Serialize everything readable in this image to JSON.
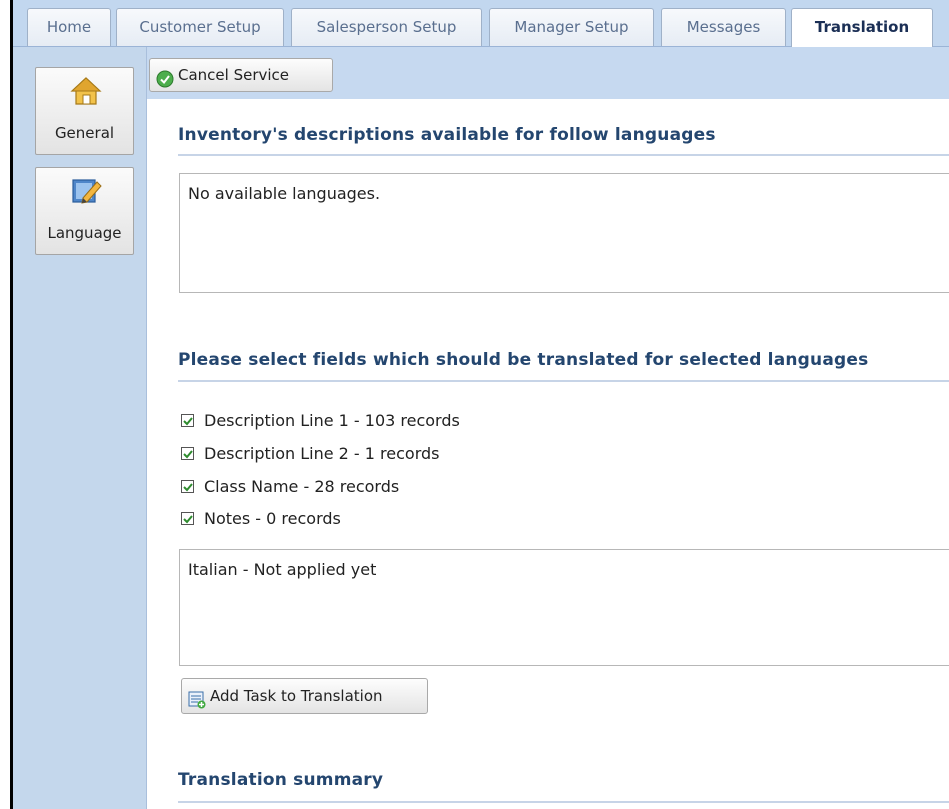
{
  "tabs": [
    {
      "label": "Home",
      "active": false
    },
    {
      "label": "Customer Setup",
      "active": false
    },
    {
      "label": "Salesperson Setup",
      "active": false
    },
    {
      "label": "Manager Setup",
      "active": false
    },
    {
      "label": "Messages",
      "active": false
    },
    {
      "label": "Translation",
      "active": true
    }
  ],
  "sidebar": {
    "items": [
      {
        "label": "General",
        "icon": "house-icon"
      },
      {
        "label": "Language",
        "icon": "pencil-edit-icon"
      }
    ]
  },
  "toolbar": {
    "cancel_label": "Cancel Service",
    "cancel_icon": "green-check-icon"
  },
  "sections": {
    "available_heading": "Inventory's descriptions available for follow languages",
    "available_text": "No available languages.",
    "fields_heading": "Please select fields which should be translated for selected languages",
    "fields": [
      {
        "label": "Description Line 1 - 103 records",
        "checked": true
      },
      {
        "label": "Description Line 2 - 1 records",
        "checked": true
      },
      {
        "label": "Class Name - 28 records",
        "checked": true
      },
      {
        "label": "Notes - 0 records",
        "checked": true
      }
    ],
    "languages_text": "Italian - Not applied yet",
    "add_task_label": "Add Task to Translation",
    "add_task_icon": "add-task-icon",
    "summary_heading": "Translation summary"
  },
  "colors": {
    "accent": "#24466f",
    "panel": "#c4d7ec",
    "tabbar": "#c2d7ef"
  }
}
